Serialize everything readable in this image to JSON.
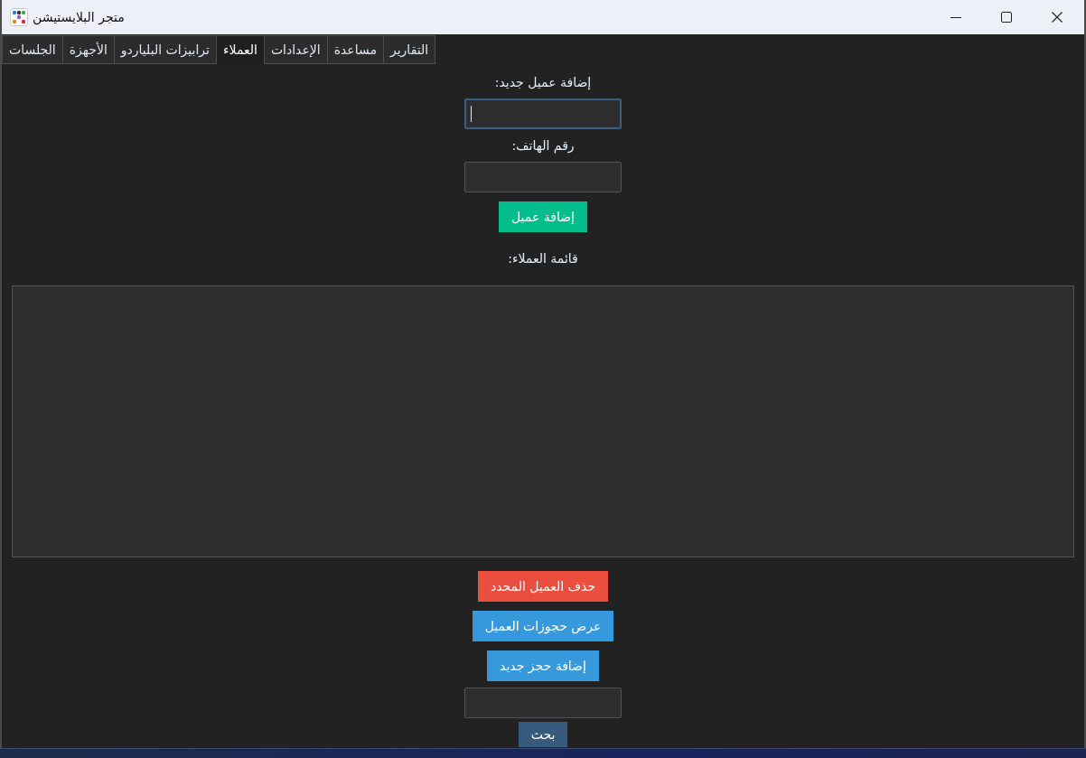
{
  "window": {
    "title": "متجر البلايستيشن"
  },
  "tabs": [
    {
      "label": "التقارير",
      "selected": false
    },
    {
      "label": "مساعدة",
      "selected": false
    },
    {
      "label": "الإعدادات",
      "selected": false
    },
    {
      "label": "العملاء",
      "selected": true
    },
    {
      "label": "ترابيزات البلياردو",
      "selected": false
    },
    {
      "label": "الأجهزة",
      "selected": false
    },
    {
      "label": "الجلسات",
      "selected": false
    }
  ],
  "form": [
    {
      "kind": "label",
      "text": "إضافة عميل جديد:"
    },
    {
      "kind": "field",
      "focused": true
    },
    {
      "kind": "label",
      "text": "رقم الهاتف:"
    },
    {
      "kind": "field",
      "focused": false
    },
    {
      "kind": "button",
      "label": "إضافة عميل",
      "color": "#00bd8b"
    },
    {
      "kind": "label",
      "text": "قائمة العملاء:"
    },
    {
      "kind": "listbox"
    },
    {
      "kind": "button",
      "label": "حذف العميل المحدد",
      "color": "#e94e3e"
    },
    {
      "kind": "button",
      "label": "عرض حجوزات العميل",
      "color": "#3699dc"
    },
    {
      "kind": "button",
      "label": "إضافة حجز جديد",
      "color": "#3699dc"
    },
    {
      "kind": "field",
      "focused": false
    },
    {
      "kind": "button",
      "label": "بحث",
      "color": "#365b7d"
    }
  ]
}
